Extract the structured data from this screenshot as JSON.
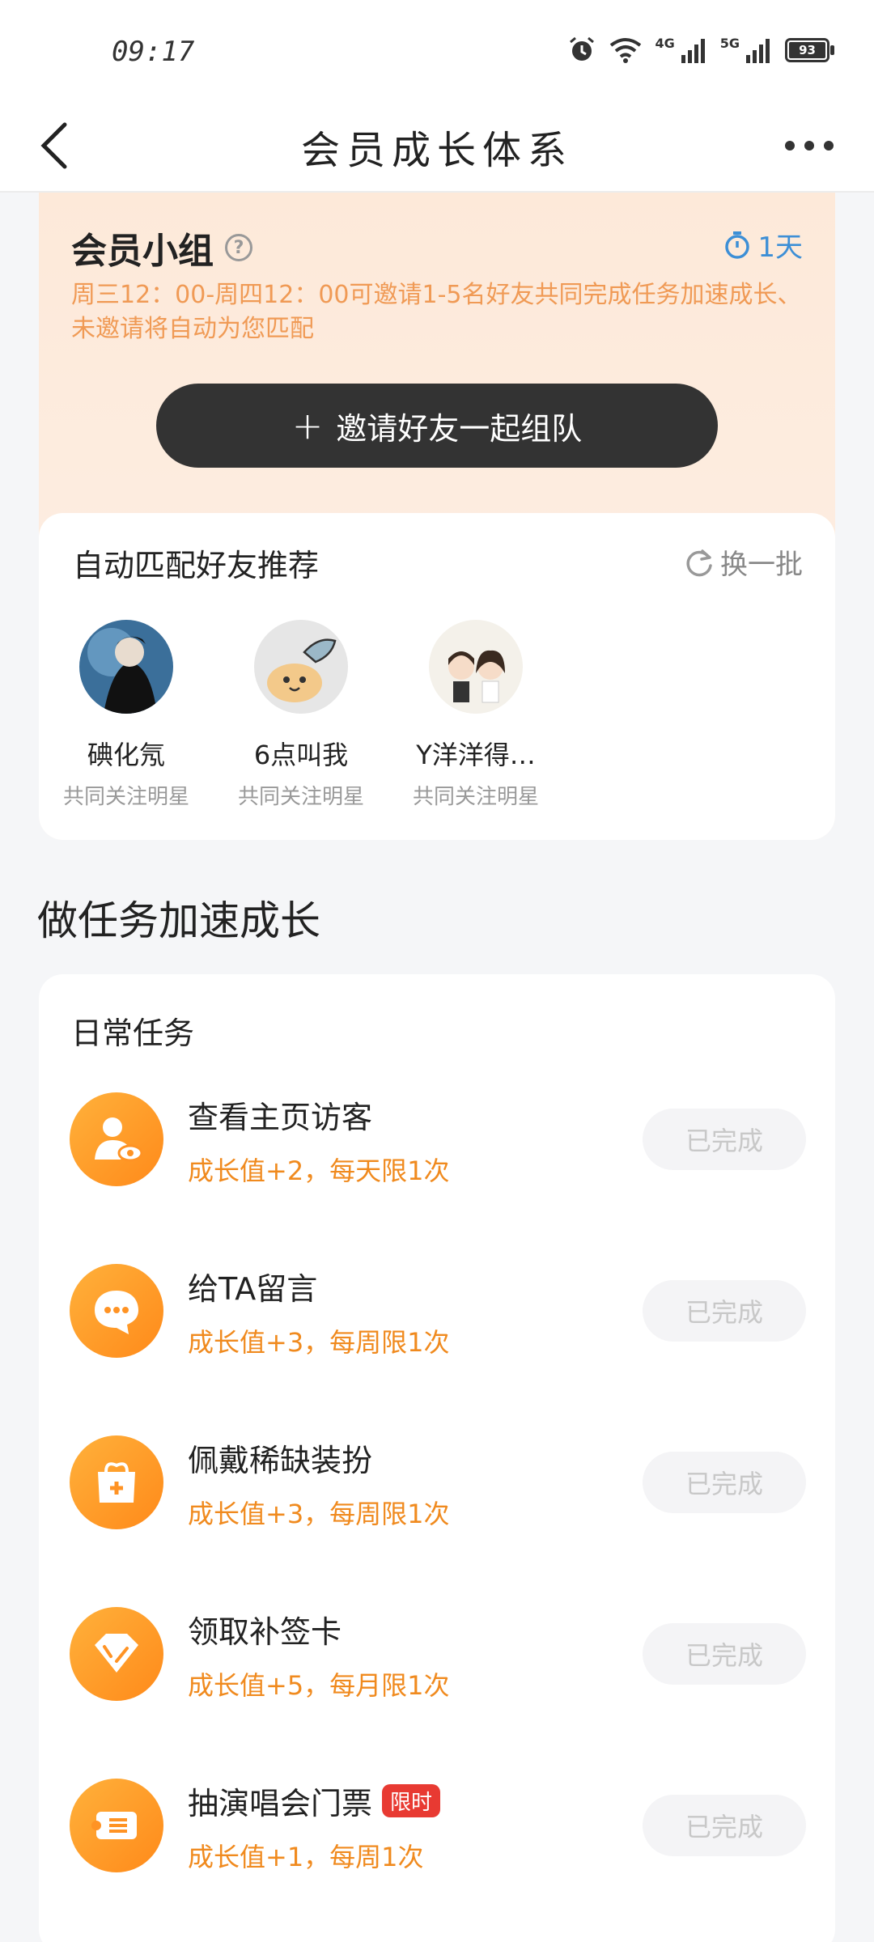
{
  "status_bar": {
    "time": "09:17",
    "net1": "4G",
    "net2": "5G",
    "battery": "93"
  },
  "header": {
    "title": "会员成长体系"
  },
  "group": {
    "title": "会员小组",
    "timer": "1天",
    "description": "周三12：00-周四12：00可邀请1-5名好友共同完成任务加速成长、未邀请将自动为您匹配",
    "invite_label": "邀请好友一起组队",
    "invite_plus": "+"
  },
  "recommend": {
    "title": "自动匹配好友推荐",
    "refresh_label": "换一批",
    "friends": [
      {
        "name": "碘化氖",
        "sub": "共同关注明星"
      },
      {
        "name": "6点叫我",
        "sub": "共同关注明星"
      },
      {
        "name": "Y洋洋得…",
        "sub": "共同关注明星"
      }
    ]
  },
  "section": {
    "title": "做任务加速成长"
  },
  "tasks": {
    "header": "日常任务",
    "items": [
      {
        "name": "查看主页访客",
        "reward": "成长值+2，每天限1次",
        "status": "已完成",
        "icon": "visitor-icon"
      },
      {
        "name": "给TA留言",
        "reward": "成长值+3，每周限1次",
        "status": "已完成",
        "icon": "message-icon"
      },
      {
        "name": "佩戴稀缺装扮",
        "reward": "成长值+3，每周限1次",
        "status": "已完成",
        "icon": "gift-box-icon"
      },
      {
        "name": "领取补签卡",
        "reward": "成长值+5，每月限1次",
        "status": "已完成",
        "icon": "diamond-icon"
      },
      {
        "name": "抽演唱会门票",
        "badge": "限时",
        "reward": "成长值+1，每周1次",
        "status": "已完成",
        "icon": "ticket-icon"
      }
    ]
  },
  "colors": {
    "accent_orange": "#f08a1e",
    "timer_blue": "#3d8fd6",
    "badge_red": "#e83a32"
  }
}
